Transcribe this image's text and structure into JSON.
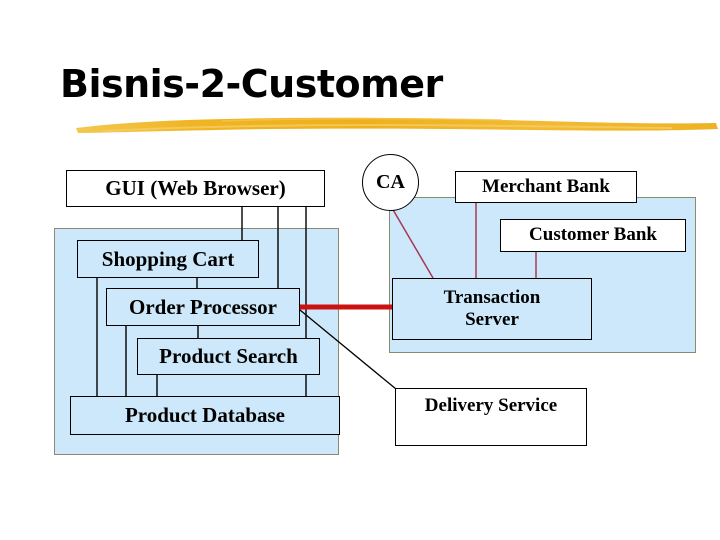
{
  "slide": {
    "title": "Bisnis-2-Customer",
    "accent_color": "#f0b323",
    "panel_fill": "#cce8fa",
    "panel_border": "#8c8a6e",
    "box_border": "#000000",
    "thin_wire_color": "#a63a52",
    "thick_wire_color": "#cc1111",
    "black_wire_color": "#000000"
  },
  "diagram": {
    "client": {
      "gui_label": "GUI (Web Browser)"
    },
    "store_panel": {
      "boxes": [
        {
          "label": "Shopping Cart"
        },
        {
          "label": "Order Processor"
        },
        {
          "label": "Product Search"
        },
        {
          "label": "Product Database"
        }
      ]
    },
    "authority": {
      "ca_label": "CA"
    },
    "payment_panel": {
      "boxes": [
        {
          "label": "Merchant Bank"
        },
        {
          "label": "Customer Bank"
        },
        {
          "label": "Transaction Server",
          "line1": "Transaction",
          "line2": "Server"
        }
      ]
    },
    "logistics": {
      "delivery_label": "Delivery Service"
    }
  }
}
